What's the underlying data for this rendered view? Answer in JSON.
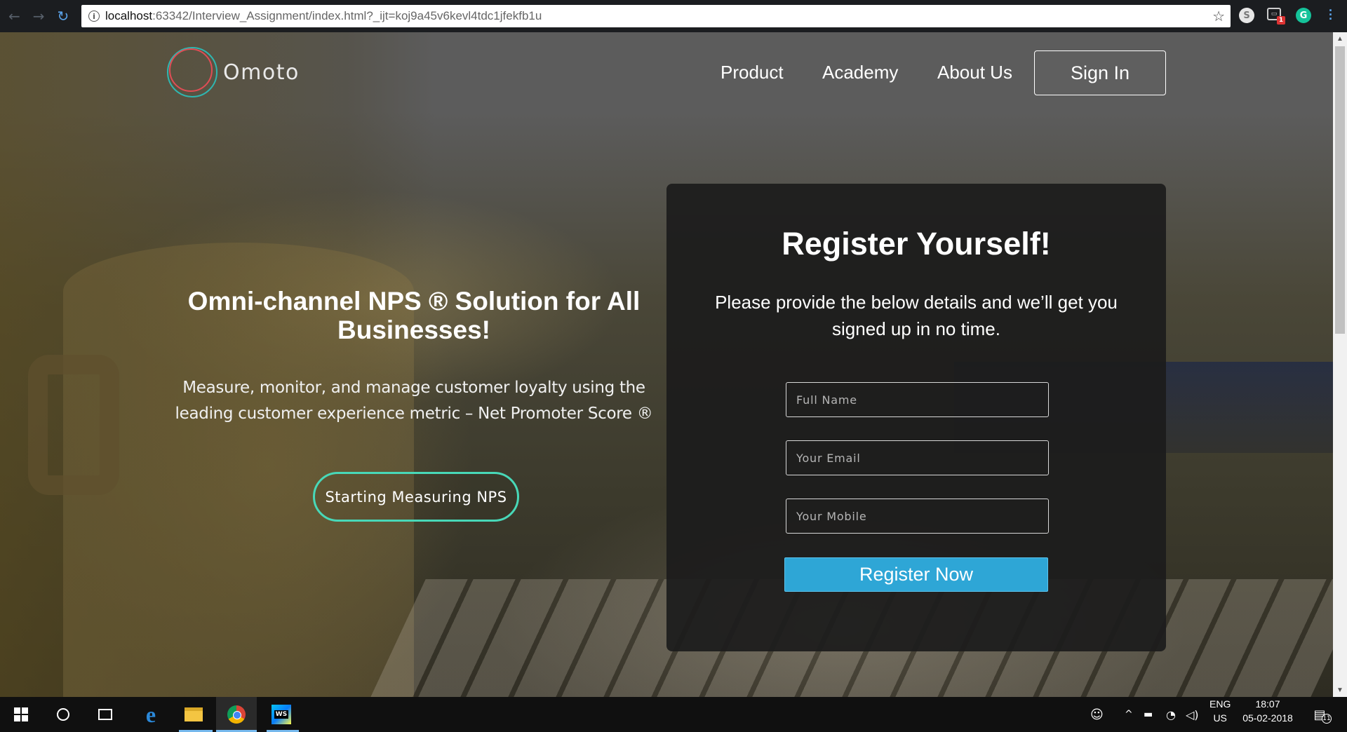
{
  "browser": {
    "url_host": "localhost",
    "url_path": ":63342/Interview_Assignment/index.html?_ijt=koj9a45v6kevl4tdc1jfekfb1u",
    "extensions": [
      "skype-icon",
      "screenshot-icon",
      "grammarly-icon"
    ],
    "extension_badge": "1"
  },
  "header": {
    "logo_text": "Omoto",
    "nav": {
      "product": "Product",
      "academy": "Academy",
      "about": "About Us",
      "signin": "Sign In"
    }
  },
  "hero": {
    "title": "Omni-channel NPS ® Solution for All Businesses!",
    "subtitle": "Measure, monitor, and manage customer loyalty using the leading customer experience metric – Net Promoter Score ®",
    "cta": "Starting Measuring NPS"
  },
  "register": {
    "title": "Register Yourself!",
    "subtitle": "Please provide the below details and we’ll get you signed up in no time.",
    "fields": {
      "name_placeholder": "Full Name",
      "email_placeholder": "Your Email",
      "mobile_placeholder": "Your Mobile"
    },
    "button": "Register Now"
  },
  "taskbar": {
    "lang_top": "ENG",
    "lang_bottom": "US",
    "time": "18:07",
    "date": "05-02-2018",
    "notif_count": "11"
  },
  "colors": {
    "accent_teal": "#48d8b8",
    "register_button": "#2ea6d6",
    "logo_red": "#e04d55",
    "logo_teal": "#2fb6b0"
  }
}
